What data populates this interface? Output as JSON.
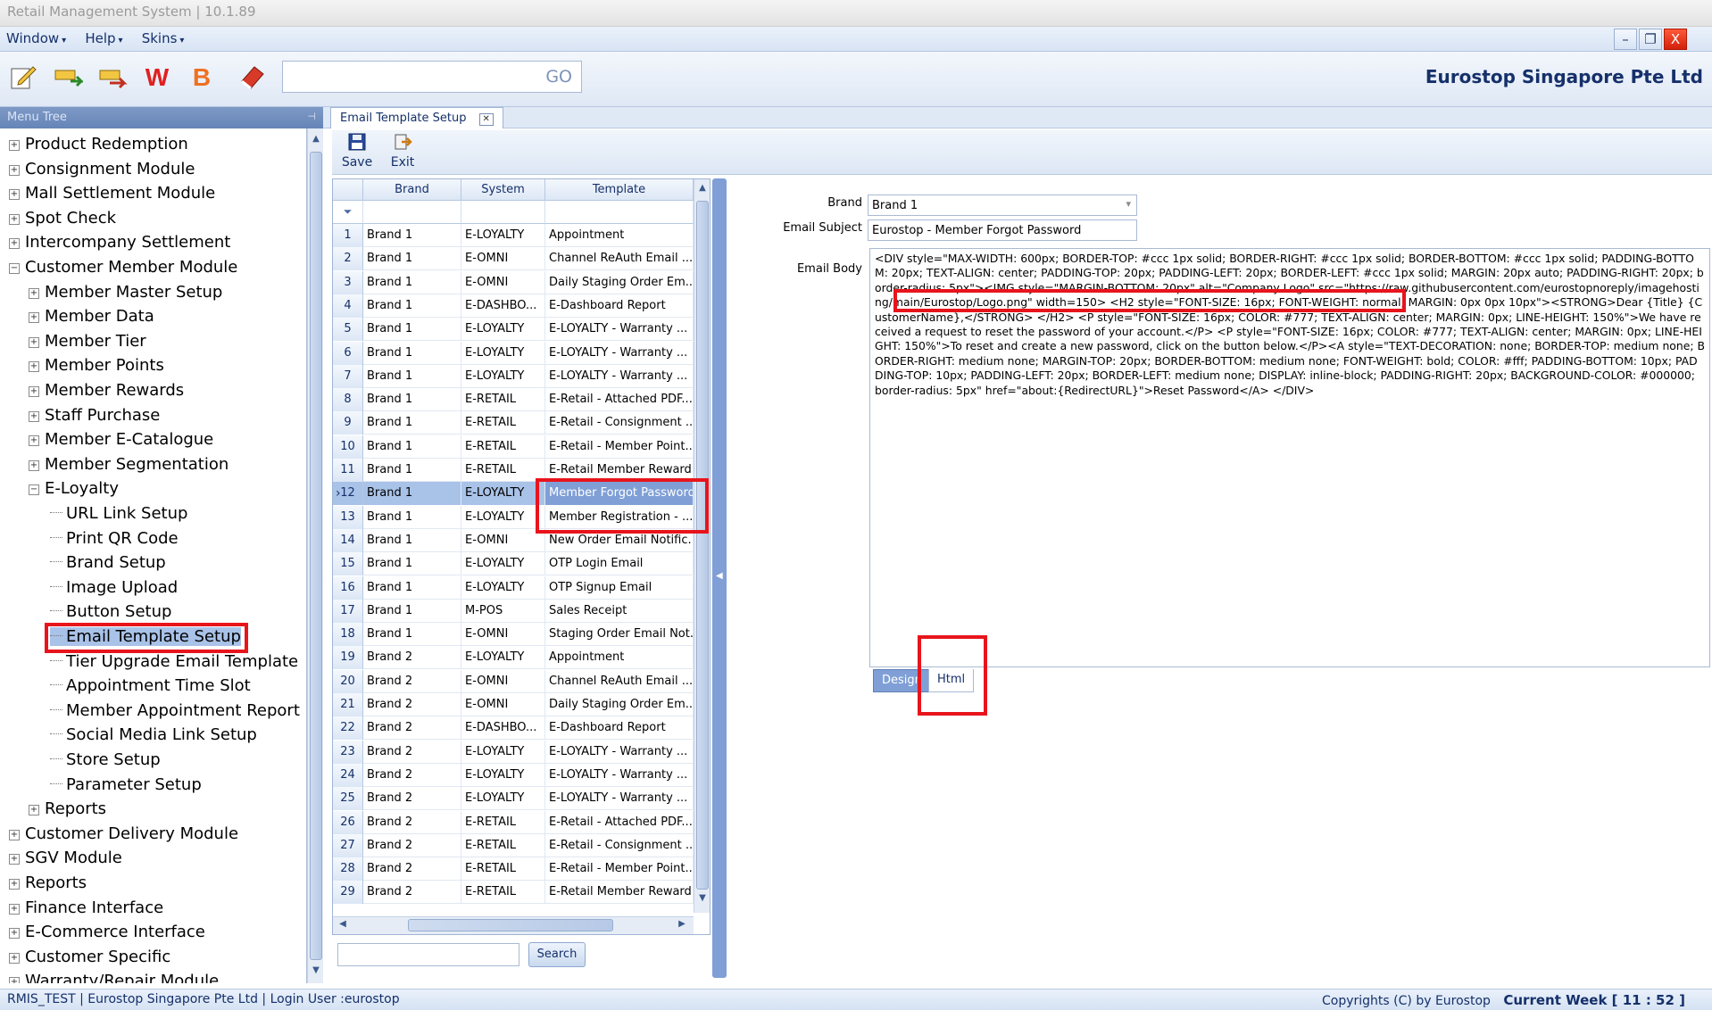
{
  "window": {
    "title": "Retail Management System | 10.1.89",
    "min_glyph": "–",
    "restore_glyph": "❐",
    "close_glyph": "X"
  },
  "menubar": {
    "items": [
      "Window",
      "Help",
      "Skins"
    ],
    "chevron": "▾"
  },
  "toolbar": {
    "icons": [
      "edit-icon",
      "transfer-icon",
      "transfer-alt-icon",
      "w-icon",
      "b-icon",
      "eraser-icon"
    ],
    "go_label": "GO",
    "company": "Eurostop Singapore Pte Ltd"
  },
  "menu_tree": {
    "title": "Menu Tree",
    "pin": "⊣",
    "items": [
      {
        "label": "Product Redemption",
        "level": 0,
        "expander": "+"
      },
      {
        "label": "Consignment Module",
        "level": 0,
        "expander": "+"
      },
      {
        "label": "Mall Settlement Module",
        "level": 0,
        "expander": "+"
      },
      {
        "label": "Spot Check",
        "level": 0,
        "expander": "+"
      },
      {
        "label": "Intercompany Settlement",
        "level": 0,
        "expander": "+"
      },
      {
        "label": "Customer Member Module",
        "level": 0,
        "expander": "−"
      },
      {
        "label": "Member Master Setup",
        "level": 1,
        "expander": "+"
      },
      {
        "label": "Member Data",
        "level": 1,
        "expander": "+"
      },
      {
        "label": "Member Tier",
        "level": 1,
        "expander": "+"
      },
      {
        "label": "Member Points",
        "level": 1,
        "expander": "+"
      },
      {
        "label": "Member Rewards",
        "level": 1,
        "expander": "+"
      },
      {
        "label": "Staff Purchase",
        "level": 1,
        "expander": "+"
      },
      {
        "label": "Member E-Catalogue",
        "level": 1,
        "expander": "+"
      },
      {
        "label": "Member Segmentation",
        "level": 1,
        "expander": "+"
      },
      {
        "label": "E-Loyalty",
        "level": 1,
        "expander": "−"
      },
      {
        "label": "URL Link Setup",
        "level": 2,
        "expander": ""
      },
      {
        "label": "Print QR Code",
        "level": 2,
        "expander": ""
      },
      {
        "label": "Brand Setup",
        "level": 2,
        "expander": ""
      },
      {
        "label": "Image Upload",
        "level": 2,
        "expander": ""
      },
      {
        "label": "Button Setup",
        "level": 2,
        "expander": ""
      },
      {
        "label": "Email Template Setup",
        "level": 2,
        "expander": "",
        "selected": true
      },
      {
        "label": "Tier Upgrade Email Template",
        "level": 2,
        "expander": ""
      },
      {
        "label": "Appointment Time Slot",
        "level": 2,
        "expander": ""
      },
      {
        "label": "Member Appointment Report",
        "level": 2,
        "expander": ""
      },
      {
        "label": "Social Media Link Setup",
        "level": 2,
        "expander": ""
      },
      {
        "label": "Store Setup",
        "level": 2,
        "expander": ""
      },
      {
        "label": "Parameter Setup",
        "level": 2,
        "expander": ""
      },
      {
        "label": "Reports",
        "level": 1,
        "expander": "+"
      },
      {
        "label": "Customer Delivery Module",
        "level": 0,
        "expander": "+"
      },
      {
        "label": "SGV Module",
        "level": 0,
        "expander": "+"
      },
      {
        "label": "Reports",
        "level": 0,
        "expander": "+"
      },
      {
        "label": "Finance Interface",
        "level": 0,
        "expander": "+"
      },
      {
        "label": "E-Commerce Interface",
        "level": 0,
        "expander": "+"
      },
      {
        "label": "Customer Specific",
        "level": 0,
        "expander": "+"
      },
      {
        "label": "Warranty/Repair Module",
        "level": 0,
        "expander": "+"
      }
    ]
  },
  "document_tab": {
    "label": "Email Template Setup",
    "close": "✕"
  },
  "actions": [
    {
      "label": "Save",
      "icon": "save-icon",
      "glyph": "💾"
    },
    {
      "label": "Exit",
      "icon": "exit-icon",
      "glyph": "⇱"
    }
  ],
  "grid": {
    "columns": [
      "Brand",
      "System",
      "Template"
    ],
    "filter_glyph": "⏷",
    "current_marker": "›",
    "rows": [
      [
        "1",
        "Brand 1",
        "E-LOYALTY",
        "Appointment"
      ],
      [
        "2",
        "Brand 1",
        "E-OMNI",
        "Channel ReAuth Email ..."
      ],
      [
        "3",
        "Brand 1",
        "E-OMNI",
        "Daily Staging Order Em..."
      ],
      [
        "4",
        "Brand 1",
        "E-DASHBO...",
        "E-Dashboard Report"
      ],
      [
        "5",
        "Brand 1",
        "E-LOYALTY",
        "E-LOYALTY - Warranty ..."
      ],
      [
        "6",
        "Brand 1",
        "E-LOYALTY",
        "E-LOYALTY - Warranty ..."
      ],
      [
        "7",
        "Brand 1",
        "E-LOYALTY",
        "E-LOYALTY - Warranty ..."
      ],
      [
        "8",
        "Brand 1",
        "E-RETAIL",
        "E-Retail - Attached PDF..."
      ],
      [
        "9",
        "Brand 1",
        "E-RETAIL",
        "E-Retail - Consignment ..."
      ],
      [
        "10",
        "Brand 1",
        "E-RETAIL",
        "E-Retail - Member Point..."
      ],
      [
        "11",
        "Brand 1",
        "E-RETAIL",
        "E-Retail Member Reward"
      ],
      [
        "12",
        "Brand 1",
        "E-LOYALTY",
        "Member Forgot Password"
      ],
      [
        "13",
        "Brand 1",
        "E-LOYALTY",
        "Member Registration - ..."
      ],
      [
        "14",
        "Brand 1",
        "E-OMNI",
        "New Order Email Notific..."
      ],
      [
        "15",
        "Brand 1",
        "E-LOYALTY",
        "OTP Login Email"
      ],
      [
        "16",
        "Brand 1",
        "E-LOYALTY",
        "OTP Signup Email"
      ],
      [
        "17",
        "Brand 1",
        "M-POS",
        "Sales Receipt"
      ],
      [
        "18",
        "Brand 1",
        "E-OMNI",
        "Staging Order Email Not..."
      ],
      [
        "19",
        "Brand 2",
        "E-LOYALTY",
        "Appointment"
      ],
      [
        "20",
        "Brand 2",
        "E-OMNI",
        "Channel ReAuth Email ..."
      ],
      [
        "21",
        "Brand 2",
        "E-OMNI",
        "Daily Staging Order Em..."
      ],
      [
        "22",
        "Brand 2",
        "E-DASHBO...",
        "E-Dashboard Report"
      ],
      [
        "23",
        "Brand 2",
        "E-LOYALTY",
        "E-LOYALTY - Warranty ..."
      ],
      [
        "24",
        "Brand 2",
        "E-LOYALTY",
        "E-LOYALTY - Warranty ..."
      ],
      [
        "25",
        "Brand 2",
        "E-LOYALTY",
        "E-LOYALTY - Warranty ..."
      ],
      [
        "26",
        "Brand 2",
        "E-RETAIL",
        "E-Retail - Attached PDF..."
      ],
      [
        "27",
        "Brand 2",
        "E-RETAIL",
        "E-Retail - Consignment ..."
      ],
      [
        "28",
        "Brand 2",
        "E-RETAIL",
        "E-Retail - Member Point..."
      ],
      [
        "29",
        "Brand 2",
        "E-RETAIL",
        "E-Retail Member Reward"
      ]
    ],
    "selected_row": "12"
  },
  "search": {
    "button": "Search",
    "value": ""
  },
  "form": {
    "brand_label": "Brand",
    "brand_value": "Brand 1",
    "dropdown_glyph": "▾",
    "subject_label": "Email Subject",
    "subject_value": "Eurostop - Member Forgot Password",
    "body_label": "Email Body",
    "body_html": "<DIV style=\"MAX-WIDTH: 600px; BORDER-TOP: #ccc 1px solid; BORDER-RIGHT: #ccc 1px solid; BORDER-BOTTOM: #ccc 1px solid; PADDING-BOTTOM: 20px; TEXT-ALIGN: center; PADDING-TOP: 20px; PADDING-LEFT: 20px; BORDER-LEFT: #ccc 1px solid; MARGIN: 20px auto; PADDING-RIGHT: 20px; border-radius: 5px\"><IMG style=\"MARGIN-BOTTOM: 20px\" alt=\"Company Logo\" src=\"https://raw.githubusercontent.com/eurostopnoreply/imagehosting/main/Eurostop/Logo.png\" width=150> <H2 style=\"FONT-SIZE: 16px; FONT-WEIGHT: normal; MARGIN: 0px 0px 10px\"><STRONG>Dear {Title} {CustomerName},</STRONG> </H2> <P style=\"FONT-SIZE: 16px; COLOR: #777; TEXT-ALIGN: center; MARGIN: 0px; LINE-HEIGHT: 150%\">We have received a request to reset the password of your account.</P> <P style=\"FONT-SIZE: 16px; COLOR: #777; TEXT-ALIGN: center; MARGIN: 0px; LINE-HEIGHT: 150%\">To reset and create a new password, click on the button below.</P><A style=\"TEXT-DECORATION: none; BORDER-TOP: medium none; BORDER-RIGHT: medium none; MARGIN-TOP: 20px; BORDER-BOTTOM: medium none; FONT-WEIGHT: bold; COLOR: #fff; PADDING-BOTTOM: 10px; PADDING-TOP: 10px; PADDING-LEFT: 20px; BORDER-LEFT: medium none; DISPLAY: inline-block; PADDING-RIGHT: 20px; BACKGROUND-COLOR: #000000; border-radius: 5px\" href=\"about:{RedirectURL}\">Reset Password</A> </DIV>",
    "tabs": [
      "Design",
      "Html"
    ],
    "active_tab": "Html"
  },
  "status": {
    "db": "RMIS_TEST",
    "company": "Eurostop Singapore Pte Ltd",
    "user": "Login User :eurostop",
    "copyright": "Copyrights (C) by Eurostop",
    "week": "Current Week [ 11 : 52 ]",
    "sep": "|"
  },
  "colors": {
    "accent": "#7f9fd6",
    "highlight": "#e8141c",
    "brand_text": "#15306a"
  }
}
